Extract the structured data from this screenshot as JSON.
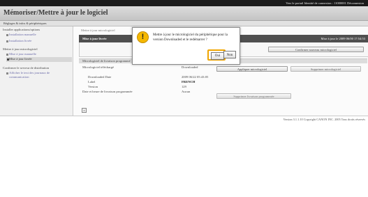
{
  "topbar": {
    "links": "Vers le portail   Identité de connexion : 11000001 Déconnexion"
  },
  "window": {
    "title": "Mémoriser/Mettre à jour le logiciel"
  },
  "subbar": {
    "breadcrumb": "Réglages & infos & périphériques"
  },
  "sidebar": {
    "items": [
      {
        "label": "Installer applications/options",
        "type": "heading"
      },
      {
        "label": "Installation manuelle",
        "type": "item"
      },
      {
        "label": "Installation livrée",
        "type": "item"
      },
      {
        "label": "Mettre à jour micrologiciel",
        "type": "heading"
      },
      {
        "label": "Mise à jour manuelle",
        "type": "item"
      },
      {
        "label": "Mise à jour livrée",
        "type": "selected"
      },
      {
        "label": "Confirmer le serveur de distribution",
        "type": "heading"
      },
      {
        "label": "Afficher le text des journaux de communication",
        "type": "item"
      }
    ]
  },
  "content": {
    "breadcrumb": "Mettre à jour micrologiciel",
    "panel_title": "Mise à jour livrée",
    "panel_date": "Mise à jour le 2009 06/00 17:54:53",
    "confirm_button": "Confirmer nouveau micrologiciel",
    "section_title": "Micrologiciel de livraison programmé",
    "rows": [
      {
        "label": "Micrologiciel téléchargé",
        "value": "Downloaded"
      },
      {
        "label": "Downloaded Date",
        "value": "2009 06/22 05:43:05"
      },
      {
        "label": "Label",
        "value": "FRENCH"
      },
      {
        "label": "Version",
        "value": "129"
      },
      {
        "label": "Date et heure de livraison programmée",
        "value": "Aucun"
      }
    ],
    "apply_button": "Appliquer micrologiciel",
    "delete_button": "Supprimer micrologiciel",
    "schedule_button": "Supprimer livraison programmée"
  },
  "footer": {
    "text": "Version 3.1.1.10 Copyright CANON INC. 2005 Tous droits réservés"
  },
  "dialog": {
    "icon": "warning-icon",
    "message": "Mettre à jour le micrologiciel du périphérique pour la version Downloaded et le redémarrer ?",
    "ok_label": "Oui",
    "no_label": "Non"
  }
}
